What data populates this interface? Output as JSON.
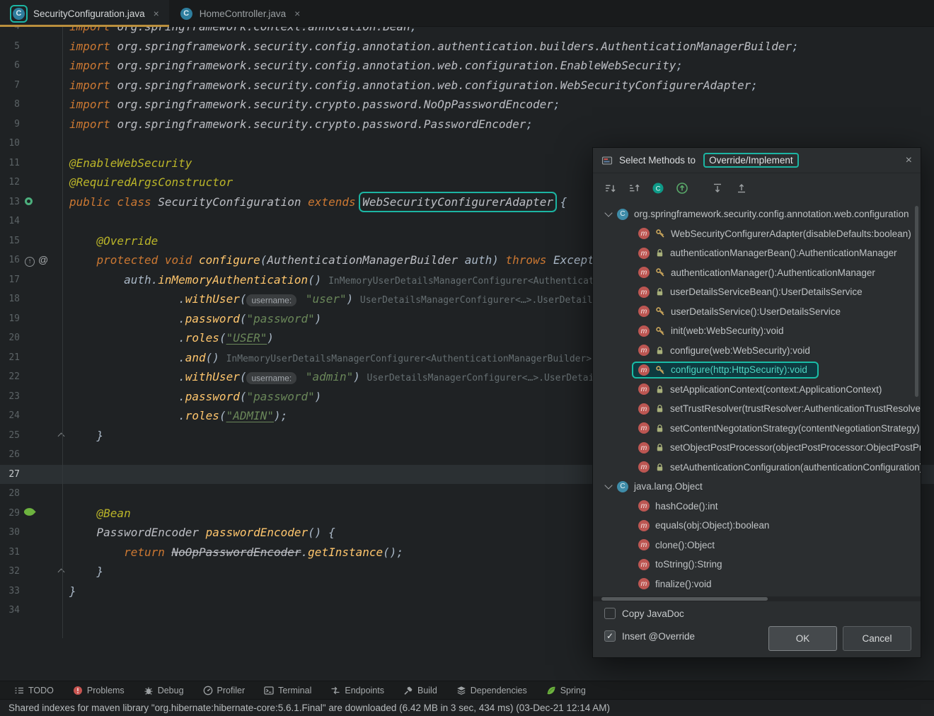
{
  "window": {
    "tabs": [
      {
        "label": "SecurityConfiguration.java",
        "active": true,
        "icon": "java-class-icon",
        "annotated": true,
        "close": "×"
      },
      {
        "label": "HomeController.java",
        "active": false,
        "icon": "java-class-icon",
        "annotated": false,
        "close": "×"
      }
    ]
  },
  "editor": {
    "lines": [
      {
        "num": 4,
        "segs": [
          {
            "t": "kw",
            "s": "import "
          },
          {
            "t": "cls",
            "s": "org.springframework.context.annotation.Bean"
          },
          {
            "t": "pln",
            "s": ";"
          }
        ]
      },
      {
        "num": 5,
        "segs": [
          {
            "t": "kw",
            "s": "import "
          },
          {
            "t": "cls",
            "s": "org.springframework.security.config.annotation.authentication.builders.AuthenticationManagerBuilder"
          },
          {
            "t": "pln",
            "s": ";"
          }
        ]
      },
      {
        "num": 6,
        "segs": [
          {
            "t": "kw",
            "s": "import "
          },
          {
            "t": "cls",
            "s": "org.springframework.security.config.annotation.web.configuration.EnableWebSecurity"
          },
          {
            "t": "pln",
            "s": ";"
          }
        ]
      },
      {
        "num": 7,
        "segs": [
          {
            "t": "kw",
            "s": "import "
          },
          {
            "t": "cls",
            "s": "org.springframework.security.config.annotation.web.configuration.WebSecurityConfigurerAdapter"
          },
          {
            "t": "pln",
            "s": ";"
          }
        ]
      },
      {
        "num": 8,
        "segs": [
          {
            "t": "kw",
            "s": "import "
          },
          {
            "t": "cls",
            "s": "org.springframework.security.crypto.password.NoOpPasswordEncoder"
          },
          {
            "t": "pln",
            "s": ";"
          }
        ]
      },
      {
        "num": 9,
        "segs": [
          {
            "t": "kw",
            "s": "import "
          },
          {
            "t": "cls",
            "s": "org.springframework.security.crypto.password.PasswordEncoder"
          },
          {
            "t": "pln",
            "s": ";"
          }
        ]
      },
      {
        "num": 10,
        "segs": []
      },
      {
        "num": 11,
        "segs": [
          {
            "t": "ann",
            "s": "@EnableWebSecurity"
          }
        ]
      },
      {
        "num": 12,
        "segs": [
          {
            "t": "ann",
            "s": "@RequiredArgsConstructor"
          }
        ]
      },
      {
        "num": 13,
        "gutter": [
          "spring-bean-icon"
        ],
        "segs": [
          {
            "t": "kw",
            "s": "public class "
          },
          {
            "t": "cls",
            "s": "SecurityConfiguration"
          },
          {
            "t": "kw",
            "s": " extends "
          },
          {
            "t": "cls hl",
            "s": "WebSecurityConfigurerAdapter"
          },
          {
            "t": "pln",
            "s": " {"
          }
        ]
      },
      {
        "num": 14,
        "segs": []
      },
      {
        "num": 15,
        "segs": [
          {
            "t": "pln",
            "s": "    "
          },
          {
            "t": "ann",
            "s": "@Override"
          }
        ]
      },
      {
        "num": 16,
        "gutter": [
          "override-icon",
          "annotation-icon"
        ],
        "segs": [
          {
            "t": "pln",
            "s": "    "
          },
          {
            "t": "kw",
            "s": "protected void "
          },
          {
            "t": "mth",
            "s": "configure"
          },
          {
            "t": "pln",
            "s": "("
          },
          {
            "t": "cls",
            "s": "AuthenticationManagerBuilder"
          },
          {
            "t": "pln",
            "s": " auth) "
          },
          {
            "t": "kw",
            "s": "throws "
          },
          {
            "t": "pln",
            "s": "Exception {"
          }
        ]
      },
      {
        "num": 17,
        "segs": [
          {
            "t": "pln",
            "s": "        auth."
          },
          {
            "t": "mth",
            "s": "inMemoryAuthentication"
          },
          {
            "t": "pln",
            "s": "() "
          },
          {
            "t": "inlay",
            "s": "InMemoryUserDetailsManagerConfigurer<AuthenticationManagerBuilder>"
          }
        ]
      },
      {
        "num": 18,
        "segs": [
          {
            "t": "pln",
            "s": "                ."
          },
          {
            "t": "mth",
            "s": "withUser"
          },
          {
            "t": "pln",
            "s": "("
          },
          {
            "t": "chip",
            "s": "username:"
          },
          {
            "t": "pln",
            "s": " "
          },
          {
            "t": "str",
            "s": "\"user\""
          },
          {
            "t": "pln",
            "s": ") "
          },
          {
            "t": "inlay",
            "s": "UserDetailsManagerConfigurer<…>.UserDetailsBuilder"
          }
        ]
      },
      {
        "num": 19,
        "segs": [
          {
            "t": "pln",
            "s": "                ."
          },
          {
            "t": "mth",
            "s": "password"
          },
          {
            "t": "pln",
            "s": "("
          },
          {
            "t": "str",
            "s": "\"password\""
          },
          {
            "t": "pln",
            "s": ")"
          }
        ]
      },
      {
        "num": 20,
        "segs": [
          {
            "t": "pln",
            "s": "                ."
          },
          {
            "t": "mth",
            "s": "roles"
          },
          {
            "t": "pln",
            "s": "("
          },
          {
            "t": "str und",
            "s": "\"USER\""
          },
          {
            "t": "pln",
            "s": ")"
          }
        ]
      },
      {
        "num": 21,
        "segs": [
          {
            "t": "pln",
            "s": "                ."
          },
          {
            "t": "mth",
            "s": "and"
          },
          {
            "t": "pln",
            "s": "() "
          },
          {
            "t": "inlay",
            "s": "InMemoryUserDetailsManagerConfigurer<AuthenticationManagerBuilder>"
          }
        ]
      },
      {
        "num": 22,
        "segs": [
          {
            "t": "pln",
            "s": "                ."
          },
          {
            "t": "mth",
            "s": "withUser"
          },
          {
            "t": "pln",
            "s": "("
          },
          {
            "t": "chip",
            "s": "username:"
          },
          {
            "t": "pln",
            "s": " "
          },
          {
            "t": "str",
            "s": "\"admin\""
          },
          {
            "t": "pln",
            "s": ") "
          },
          {
            "t": "inlay",
            "s": "UserDetailsManagerConfigurer<…>.UserDetailsBuilder"
          }
        ]
      },
      {
        "num": 23,
        "segs": [
          {
            "t": "pln",
            "s": "                ."
          },
          {
            "t": "mth",
            "s": "password"
          },
          {
            "t": "pln",
            "s": "("
          },
          {
            "t": "str",
            "s": "\"password\""
          },
          {
            "t": "pln",
            "s": ")"
          }
        ]
      },
      {
        "num": 24,
        "segs": [
          {
            "t": "pln",
            "s": "                ."
          },
          {
            "t": "mth",
            "s": "roles"
          },
          {
            "t": "pln",
            "s": "("
          },
          {
            "t": "str und",
            "s": "\"ADMIN\""
          },
          {
            "t": "pln",
            "s": ");"
          }
        ]
      },
      {
        "num": 25,
        "fold": true,
        "segs": [
          {
            "t": "pln",
            "s": "    }"
          }
        ]
      },
      {
        "num": 26,
        "segs": []
      },
      {
        "num": 27,
        "current": true,
        "segs": []
      },
      {
        "num": 28,
        "segs": []
      },
      {
        "num": 29,
        "gutter": [
          "spring-leaf-icon"
        ],
        "segs": [
          {
            "t": "pln",
            "s": "    "
          },
          {
            "t": "ann",
            "s": "@Bean"
          }
        ]
      },
      {
        "num": 30,
        "segs": [
          {
            "t": "pln",
            "s": "    "
          },
          {
            "t": "cls",
            "s": "PasswordEncoder"
          },
          {
            "t": "pln",
            "s": " "
          },
          {
            "t": "mth",
            "s": "passwordEncoder"
          },
          {
            "t": "pln",
            "s": "() {"
          }
        ]
      },
      {
        "num": 31,
        "segs": [
          {
            "t": "pln",
            "s": "        "
          },
          {
            "t": "kw",
            "s": "return "
          },
          {
            "t": "cls strike",
            "s": "NoOpPasswordEncoder"
          },
          {
            "t": "pln",
            "s": "."
          },
          {
            "t": "mth",
            "s": "getInstance"
          },
          {
            "t": "pln",
            "s": "();"
          }
        ]
      },
      {
        "num": 32,
        "fold": true,
        "segs": [
          {
            "t": "pln",
            "s": "    }"
          }
        ]
      },
      {
        "num": 33,
        "segs": [
          {
            "t": "pln",
            "s": "}"
          }
        ]
      },
      {
        "num": 34,
        "segs": []
      }
    ]
  },
  "dialog": {
    "title_prefix": "Select Methods to",
    "title_highlight": "Override/Implement",
    "close": "×",
    "toolbar_icons": [
      "sort-alpha-icon",
      "sort-visibility-icon",
      "show-classes-icon",
      "show-inherited-icon",
      "expand-all-icon",
      "collapse-all-icon"
    ],
    "tree": [
      {
        "kind": "group",
        "label": "org.springframework.security.config.annotation.web.configuration"
      },
      {
        "kind": "method",
        "vis": "key",
        "label": "WebSecurityConfigurerAdapter(disableDefaults:boolean)"
      },
      {
        "kind": "method",
        "vis": "lock",
        "label": "authenticationManagerBean():AuthenticationManager"
      },
      {
        "kind": "method",
        "vis": "key",
        "label": "authenticationManager():AuthenticationManager"
      },
      {
        "kind": "method",
        "vis": "lock",
        "label": "userDetailsServiceBean():UserDetailsService"
      },
      {
        "kind": "method",
        "vis": "key",
        "label": "userDetailsService():UserDetailsService"
      },
      {
        "kind": "method",
        "vis": "key",
        "label": "init(web:WebSecurity):void"
      },
      {
        "kind": "method",
        "vis": "lock",
        "label": "configure(web:WebSecurity):void"
      },
      {
        "kind": "method",
        "vis": "key",
        "label": "configure(http:HttpSecurity):void",
        "selected": true
      },
      {
        "kind": "method",
        "vis": "lock",
        "label": "setApplicationContext(context:ApplicationContext)"
      },
      {
        "kind": "method",
        "vis": "lock",
        "label": "setTrustResolver(trustResolver:AuthenticationTrustResolver)"
      },
      {
        "kind": "method",
        "vis": "lock",
        "label": "setContentNegotationStrategy(contentNegotiationStrategy)"
      },
      {
        "kind": "method",
        "vis": "lock",
        "label": "setObjectPostProcessor(objectPostProcessor:ObjectPostProcessor)"
      },
      {
        "kind": "method",
        "vis": "lock",
        "label": "setAuthenticationConfiguration(authenticationConfiguration)"
      },
      {
        "kind": "group",
        "label": "java.lang.Object"
      },
      {
        "kind": "method",
        "vis": "none",
        "label": "hashCode():int"
      },
      {
        "kind": "method",
        "vis": "none",
        "label": "equals(obj:Object):boolean"
      },
      {
        "kind": "method",
        "vis": "none",
        "label": "clone():Object"
      },
      {
        "kind": "method",
        "vis": "none",
        "label": "toString():String"
      },
      {
        "kind": "method",
        "vis": "none",
        "label": "finalize():void"
      }
    ],
    "copy_javadoc_label": "Copy JavaDoc",
    "insert_override_label": "Insert @Override",
    "ok_label": "OK",
    "cancel_label": "Cancel"
  },
  "bottom_bar": {
    "items": [
      {
        "icon": "todo-icon",
        "label": "TODO"
      },
      {
        "icon": "problems-icon",
        "label": "Problems"
      },
      {
        "icon": "debug-icon",
        "label": "Debug"
      },
      {
        "icon": "profiler-icon",
        "label": "Profiler"
      },
      {
        "icon": "terminal-icon",
        "label": "Terminal"
      },
      {
        "icon": "endpoints-icon",
        "label": "Endpoints"
      },
      {
        "icon": "build-icon",
        "label": "Build"
      },
      {
        "icon": "dependencies-icon",
        "label": "Dependencies"
      },
      {
        "icon": "spring-icon",
        "label": "Spring"
      }
    ]
  },
  "status_bar": {
    "message": "Shared indexes for maven library \"org.hibernate:hibernate-core:5.6.1.Final\" are downloaded (6.42 MB in 3 sec, 434 ms) (03-Dec-21 12:14 AM)"
  },
  "colors": {
    "accent_teal": "#1CB5A3",
    "tab_underline_gold": "#BA8F3D",
    "keyword_orange": "#CC7832",
    "string_green": "#6A8759",
    "annotation_yellow": "#BBB529",
    "method_yellow": "#FFC66D",
    "spring_green": "#6DB33F",
    "error_red": "#C75450"
  }
}
